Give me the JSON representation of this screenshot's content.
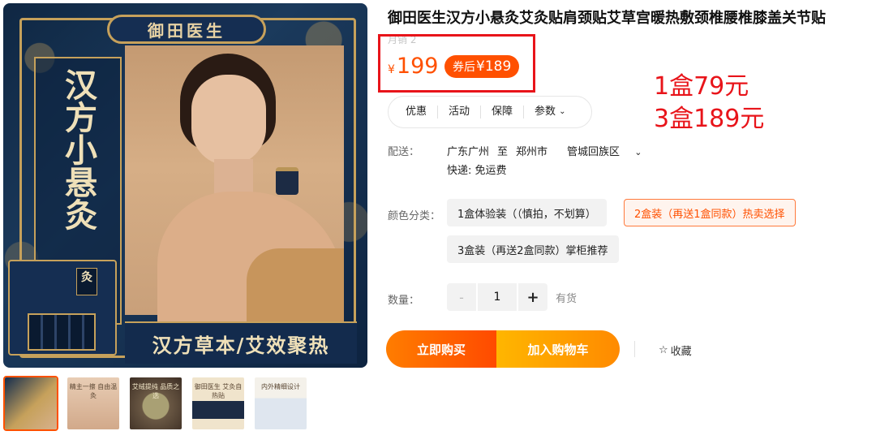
{
  "main_image": {
    "brand": "御田医生",
    "vertical_title": "汉方小悬灸",
    "slogan": "汉方草本/艾效聚热",
    "box_seal": "灸"
  },
  "thumbnails": [
    {
      "caption": "",
      "icon": "product-photo-model"
    },
    {
      "caption": "精主一擦 自由温灸",
      "icon": "product-photo-detail"
    },
    {
      "caption": "艾绒提纯 品质之选",
      "icon": "product-photo-moxa"
    },
    {
      "caption": "御田医生 艾灸自热贴",
      "icon": "product-photo-package"
    },
    {
      "caption": "内外精细设计",
      "icon": "product-photo-design"
    }
  ],
  "product": {
    "title": "御田医生汉方小悬灸艾灸贴肩颈贴艾草宫暖热敷颈椎腰椎膝盖关节贴",
    "monthly_sales": "月销 2",
    "price_symbol": "¥",
    "price": "199",
    "coupon_prefix": "券后",
    "coupon_price": "¥189"
  },
  "annotations": [
    "1盒79元",
    "3盒189元"
  ],
  "tabs": [
    {
      "label": "优惠"
    },
    {
      "label": "活动"
    },
    {
      "label": "保障"
    },
    {
      "label": "参数",
      "icon": "chevron-down-icon"
    }
  ],
  "shipping": {
    "label": "配送：",
    "from": "广东广州",
    "to_word": "至",
    "city": "郑州市",
    "district": "管城回族区",
    "fee": "快递: 免运费"
  },
  "variants": {
    "label": "颜色分类：",
    "options": [
      {
        "label": "1盒体验装（（慎拍，不划算）",
        "selected": false
      },
      {
        "label": "2盒装（再送1盒同款）热卖选择",
        "selected": true
      },
      {
        "label": "3盒装（再送2盒同款）掌柜推荐",
        "selected": false
      }
    ]
  },
  "quantity": {
    "label": "数量：",
    "minus": "-",
    "value": "1",
    "plus": "+",
    "stock": "有货"
  },
  "actions": {
    "buy_now": "立即购买",
    "add_cart": "加入购物车",
    "favorite": "收藏"
  },
  "colors": {
    "accent": "#ff5000",
    "annotation_red": "#e8141a",
    "brand_navy": "#152e52",
    "brand_gold": "#c6a15b"
  }
}
